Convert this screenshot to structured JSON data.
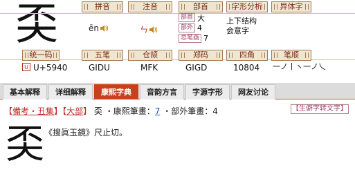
{
  "character": "奀",
  "headers": {
    "pinyin": "拼音",
    "zhuyin": "注音",
    "bushou": "部首",
    "zixing": "字形分析",
    "yitizi": "异体字",
    "tongyi": "统一码",
    "wubi": "五笔",
    "cangjie": "仓颉",
    "zhengma": "郑码",
    "sijiao": "四角",
    "bishun": "笔顺"
  },
  "pinyin": "ēn",
  "zhuyin": "ㄣ",
  "bushou": {
    "bushou_tag": "部首",
    "bushou_value": "大",
    "buwai_tag": "部外",
    "buwai_value": "4",
    "zongbihua_tag": "总笔画",
    "zongbihua_value": "7"
  },
  "zixing": [
    "上下结构",
    "会意字"
  ],
  "unicode": "U+5940",
  "wubi": "GIDU",
  "cangjie": "MFK",
  "zhengma": "GIGD",
  "sijiao": "10804",
  "bishun": "一ノ丨ヽ一ノ乀",
  "tabs": [
    "基本解释",
    "详细解释",
    "康熙字典",
    "音韵方言",
    "字源字形",
    "网友讨论"
  ],
  "kangxi": {
    "ref_open": "【",
    "ref_label": "備考・丑集",
    "ref_close": "】",
    "bu_open": "【",
    "bu_label": "大部",
    "bu_close": "】",
    "char": "奀",
    "bihua_label": "・康熙筆畫：",
    "bihua_value": "7",
    "buwai_label": "・部外筆畫：",
    "buwai_value": "4",
    "convert_label": "【生僻字转文字】",
    "definition": "《搜眞玉鏡》尺止切。"
  }
}
